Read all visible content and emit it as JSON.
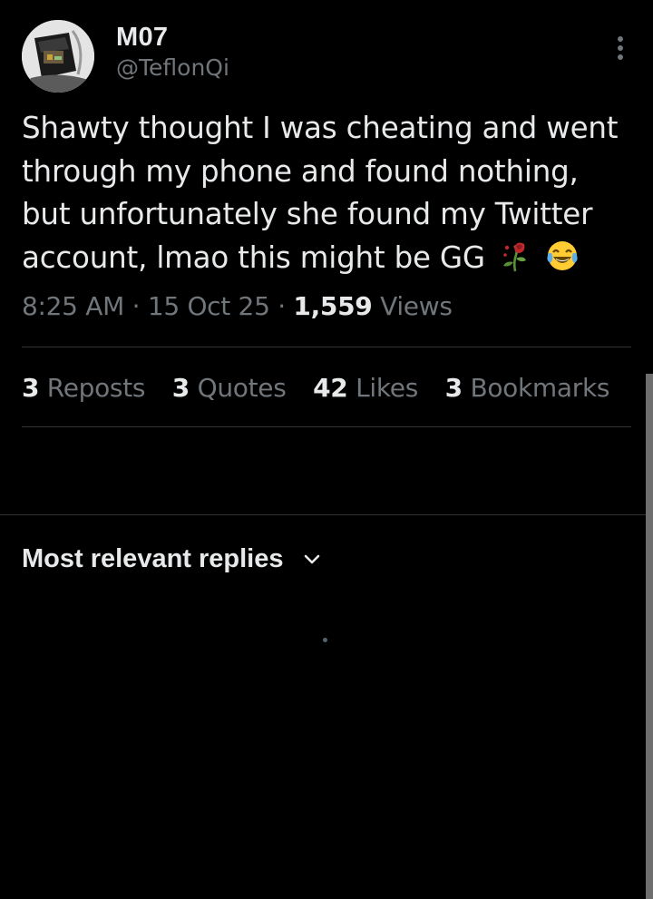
{
  "author": {
    "display_name": "M07",
    "handle": "@TeflonQi",
    "avatar_icon": "profile-photo"
  },
  "tweet": {
    "text": "Shawty thought I was cheating and went through my phone and found nothing, but unfortunately she found my Twitter account, lmao this might be GG",
    "emojis": [
      "wilted-flower-icon",
      "face-with-tears-of-joy-icon"
    ]
  },
  "meta": {
    "time": "8:25 AM",
    "separator": " · ",
    "date": "15 Oct 25",
    "views_count": "1,559",
    "views_label": "Views"
  },
  "stats": [
    {
      "count": "3",
      "label": "Reposts"
    },
    {
      "count": "3",
      "label": "Quotes"
    },
    {
      "count": "42",
      "label": "Likes"
    },
    {
      "count": "3",
      "label": "Bookmarks"
    }
  ],
  "replies": {
    "sort_label": "Most relevant replies"
  },
  "colors": {
    "background": "#000000",
    "primary_text": "#e7e9ea",
    "secondary_text": "#71767b",
    "divider": "#2f3336"
  }
}
